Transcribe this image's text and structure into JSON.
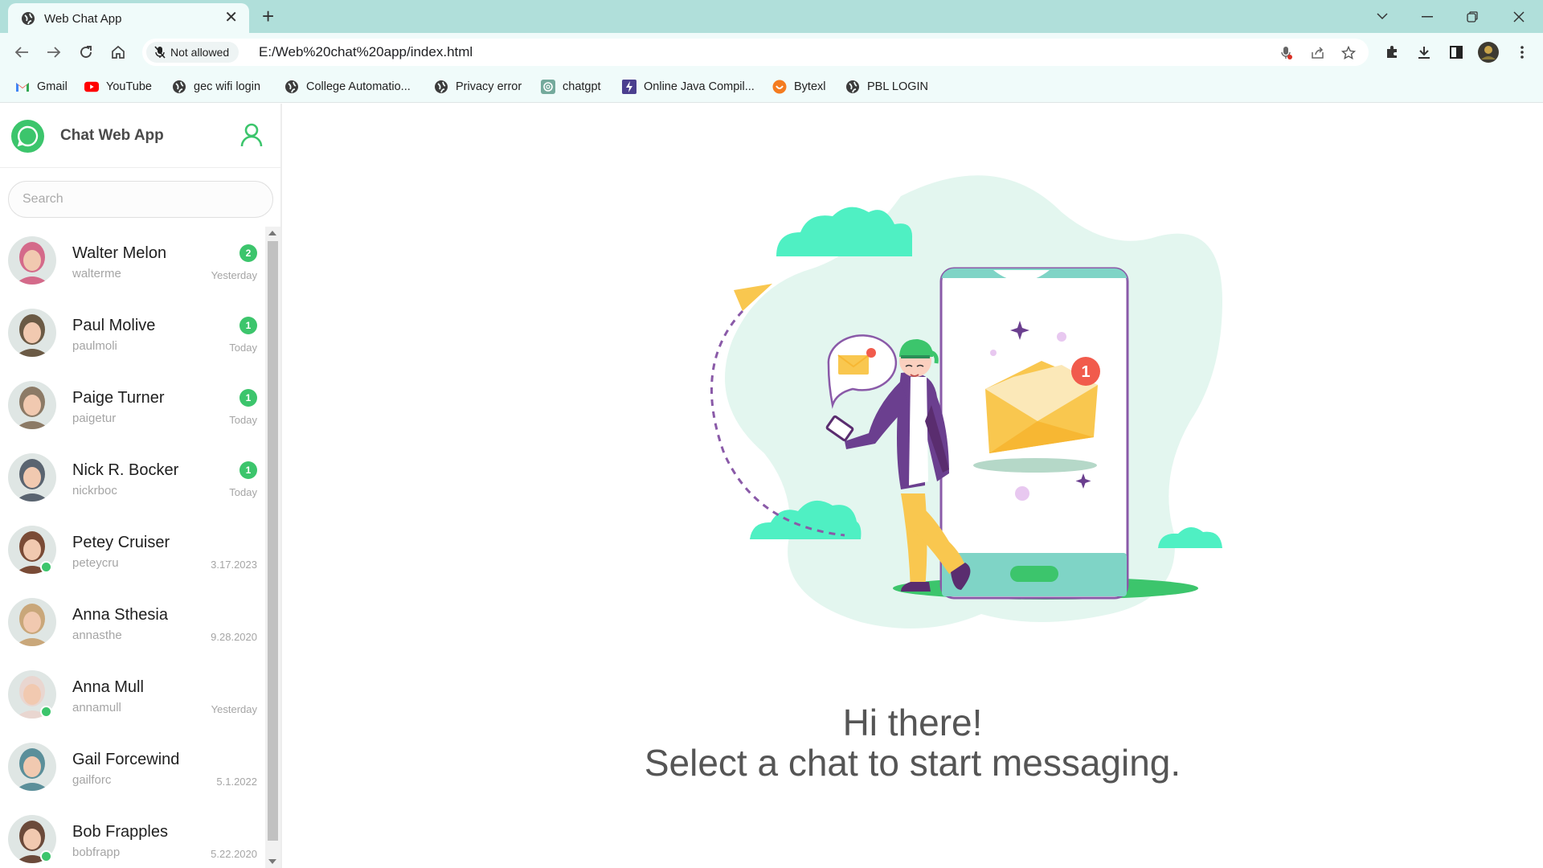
{
  "browser": {
    "tab_title": "Web Chat App",
    "site_chip": "Not allowed",
    "url": "E:/Web%20chat%20app/index.html",
    "bookmarks": [
      {
        "label": "Gmail",
        "icon": "gmail-icon"
      },
      {
        "label": "YouTube",
        "icon": "youtube-icon"
      },
      {
        "label": "gec wifi login",
        "icon": "globe-icon"
      },
      {
        "label": "College Automatio...",
        "icon": "globe-icon"
      },
      {
        "label": "Privacy error",
        "icon": "globe-icon"
      },
      {
        "label": "chatgpt",
        "icon": "chatgpt-icon"
      },
      {
        "label": "Online Java Compil...",
        "icon": "bolt-icon"
      },
      {
        "label": "Bytexl",
        "icon": "bytexl-icon"
      },
      {
        "label": "PBL LOGIN",
        "icon": "globe-icon"
      }
    ]
  },
  "app": {
    "title": "Chat Web App",
    "search_placeholder": "Search",
    "brand_color": "#3cc56c",
    "contacts": [
      {
        "name": "Walter Melon",
        "handle": "walterme",
        "time": "Yesterday",
        "unread": "2",
        "online": false,
        "avatar_color": "#d46a8a"
      },
      {
        "name": "Paul Molive",
        "handle": "paulmoli",
        "time": "Today",
        "unread": "1",
        "online": false,
        "avatar_color": "#6b5a45"
      },
      {
        "name": "Paige Turner",
        "handle": "paigetur",
        "time": "Today",
        "unread": "1",
        "online": false,
        "avatar_color": "#8c7a66"
      },
      {
        "name": "Nick R. Bocker",
        "handle": "nickrboc",
        "time": "Today",
        "unread": "1",
        "online": false,
        "avatar_color": "#5a6470"
      },
      {
        "name": "Petey Cruiser",
        "handle": "peteycru",
        "time": "3.17.2023",
        "unread": "",
        "online": true,
        "avatar_color": "#7a4b36"
      },
      {
        "name": "Anna Sthesia",
        "handle": "annasthe",
        "time": "9.28.2020",
        "unread": "",
        "online": false,
        "avatar_color": "#c9a77a"
      },
      {
        "name": "Anna Mull",
        "handle": "annamull",
        "time": "Yesterday",
        "unread": "",
        "online": true,
        "avatar_color": "#e9d6d0"
      },
      {
        "name": "Gail Forcewind",
        "handle": "gailforc",
        "time": "5.1.2022",
        "unread": "",
        "online": false,
        "avatar_color": "#5b8f9a"
      },
      {
        "name": "Bob Frapples",
        "handle": "bobfrapp",
        "time": "5.22.2020",
        "unread": "",
        "online": true,
        "avatar_color": "#6b4a3a"
      }
    ]
  },
  "welcome": {
    "line1": "Hi there!",
    "line2": "Select a chat to start messaging.",
    "illustration_badge": "1"
  }
}
